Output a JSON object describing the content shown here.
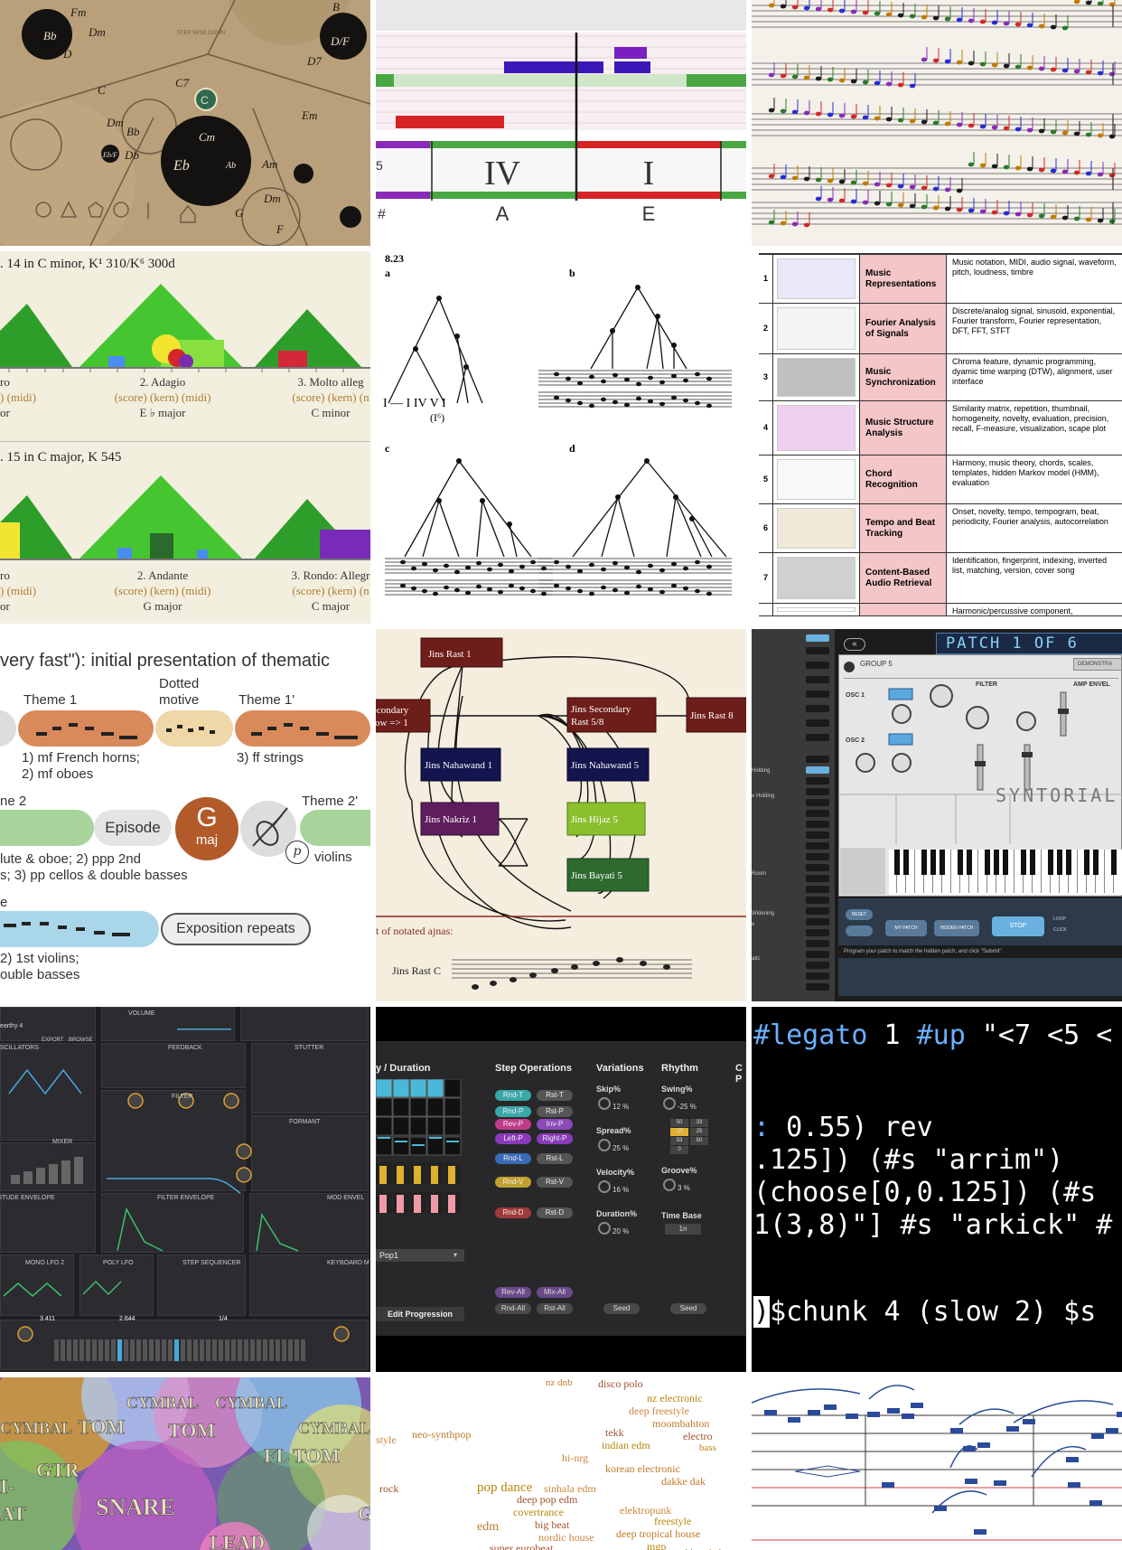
{
  "harmony_map": {
    "chords": [
      "Fm",
      "Dm",
      "B",
      "D/F",
      "D",
      "Bb",
      "D7",
      "C7",
      "Dm",
      "Em",
      "Cm",
      "Eb",
      "Am",
      "Ab",
      "Dm",
      "F",
      "Eb/F",
      "C",
      "Bb",
      "Db",
      "G"
    ],
    "center": "C",
    "main_chord": "Cm",
    "top_label": "STEP WISE DOWN"
  },
  "piano_roll": {
    "numerals": [
      "IV",
      "I"
    ],
    "notes": [
      "A",
      "E"
    ],
    "margin_labels": [
      "5",
      "#"
    ]
  },
  "score_page": {},
  "keyscape": {
    "rows": [
      {
        "title": ". 14 in C minor, K¹ 310/K⁶ 300d",
        "movements": [
          {
            "name": "ro",
            "links": ") (midi)",
            "key": "or"
          },
          {
            "name": "2. Adagio",
            "links": "(score) (kern) (midi)",
            "key": "E ♭ major"
          },
          {
            "name": "3. Molto alleg",
            "links": "(score) (kern) (n",
            "key": "C minor"
          }
        ]
      },
      {
        "title": ". 15 in C major, K 545",
        "movements": [
          {
            "name": "ro",
            "links": ") (midi)",
            "key": "or"
          },
          {
            "name": "2. Andante",
            "links": "(score) (kern) (midi)",
            "key": "G major"
          },
          {
            "name": "3. Rondo: Allegr",
            "links": "(score) (kern) (n",
            "key": "C major"
          }
        ]
      }
    ]
  },
  "tree": {
    "fig": "8.23",
    "labels": [
      "a",
      "b",
      "c",
      "d"
    ],
    "numerals": "I — I  IV V I",
    "sub": "(I⁶)"
  },
  "mir_table": {
    "rows": [
      {
        "n": "1",
        "topic": "Music Representations",
        "desc": "Music notation, MIDI, audio signal, waveform, pitch, loudness, timbre"
      },
      {
        "n": "2",
        "topic": "Fourier Analysis of Signals",
        "desc": "Discrete/analog signal, sinusoid, exponential, Fourier transform, Fourier representation, DFT, FFT, STFT"
      },
      {
        "n": "3",
        "topic": "Music Synchronization",
        "desc": "Chroma feature, dynamic programming, dyamic time warping (DTW), alignment, user interface"
      },
      {
        "n": "4",
        "topic": "Music Structure Analysis",
        "desc": "Similarity matrix, repetition, thumbnail, homogeneity, novelty, evaluation, precision, recall, F-measure, visualization, scape plot"
      },
      {
        "n": "5",
        "topic": "Chord Recognition",
        "desc": "Harmony, music theory, chords, scales, templates, hidden Markov model (HMM), evaluation"
      },
      {
        "n": "6",
        "topic": "Tempo and Beat Tracking",
        "desc": "Onset, novelty, tempo, tempogram, beat, periodicity, Fourier analysis, autocorrelation"
      },
      {
        "n": "7",
        "topic": "Content-Based Audio Retrieval",
        "desc": "Identification, fingerprint, indexing, inverted list, matching, version, cover song"
      },
      {
        "n": "",
        "topic": "",
        "desc": "Harmonic/percussive component,"
      }
    ]
  },
  "listening_guide": {
    "heading": "very fast\"): initial presentation of thematic",
    "theme1": "Theme 1",
    "dotted": "Dotted\nmotive",
    "theme1p": "Theme 1'",
    "inst1": "1) mf French horns;\n2) mf oboes",
    "inst2": "3) ff strings",
    "theme2": "ne 2",
    "theme2p": "Theme 2'",
    "episode": "Episode",
    "key_big": "G",
    "key_small": "maj",
    "dyn": "p",
    "violins": "violins",
    "inst3": "lute & oboe; 2) ppp 2nd\ns; 3) pp cellos & double basses",
    "row3": "e",
    "repeats": "Exposition repeats",
    "inst4": "2) 1st violins;\nouble basses"
  },
  "ajnas": {
    "nodes": [
      {
        "id": "rast1",
        "label": "Jins Rast 1"
      },
      {
        "id": "sec1",
        "label": "econdary\nlow => 1"
      },
      {
        "id": "sec58",
        "label": "Jins Secondary\nRast 5/8"
      },
      {
        "id": "rast8",
        "label": "Jins Rast 8"
      },
      {
        "id": "nah1",
        "label": "Jins Nahawand 1"
      },
      {
        "id": "nah5",
        "label": "Jins Nahawand 5"
      },
      {
        "id": "nak1",
        "label": "Jins Nakriz 1"
      },
      {
        "id": "hij5",
        "label": "Jins Hijaz 5"
      },
      {
        "id": "bay5",
        "label": "Jins Bayati 5"
      }
    ],
    "caption": "t of notated ajnas:",
    "scale": "Jins Rast C"
  },
  "syntorial": {
    "patch": "PATCH 1 OF 6",
    "group": "GROUP 5",
    "demo": "DEMONSTRA",
    "filter": "FILTER",
    "amp": "AMP ENVEL",
    "osc1": "OSC 1",
    "osc2": "OSC 2",
    "logo": "SYNTORIAL",
    "side_labels": [
      "Holding",
      "e Holding",
      "Room",
      "Widening",
      "e",
      "atic"
    ],
    "buttons": [
      "RESET",
      "MY PATCH",
      "HIDDEN PATCH",
      "STOP"
    ],
    "opts": [
      "LOOP",
      "CLICK"
    ],
    "footer": "Program your patch to match the hidden patch, and click \"Submit\"."
  },
  "vital": {
    "preset": "earthy 4",
    "menu": [
      "EXPORT",
      "BROWSE"
    ],
    "volume": "VOLUME",
    "feedback": "FEEDBACK",
    "stutter": "STUTTER",
    "oscillators": "SCILLATORS",
    "filter": "FILTER",
    "formant": "FORMANT",
    "mixer": "MIXER",
    "amp_env": "ITUDE ENVELOPE",
    "filter_env": "FILTER ENVELOPE",
    "mod_env": "MOD ENVEL",
    "lfo2": "MONO LFO 2",
    "poly_lfo": "POLY LFO",
    "step_seq": "STEP SEQUENCER",
    "keyboard": "KEYBOARD M",
    "val1": "3.411",
    "val2": "2.644",
    "val3": "1/4"
  },
  "progression": {
    "col1": "y / Duration",
    "col2": "Step Operations",
    "col3": "Variations",
    "col4": "Rhythm",
    "col5": "C P",
    "ops": [
      [
        "Rnd-T",
        "Rst-T"
      ],
      [
        "Rnd-P",
        "Rst-P"
      ],
      [
        "Rev-P",
        "Inv-P"
      ],
      [
        "Left-P",
        "Right-P"
      ],
      [
        "Rnd-L",
        "Rst-L"
      ],
      [
        "Rnd-V",
        "Rst-V"
      ],
      [
        "Rnd-D",
        "Rst-D"
      ]
    ],
    "vars": [
      [
        "Skip%",
        "12 %"
      ],
      [
        "Spread%",
        "25 %"
      ],
      [
        "Velocity%",
        "16 %"
      ],
      [
        "Duration%",
        "20 %"
      ]
    ],
    "swing": "Swing%",
    "swing_val": "-25 %",
    "groove": "Groove%",
    "groove_val": "3 %",
    "timebase": "Time Base",
    "timebase_val": "1n",
    "grid_vals": [
      "50",
      "33",
      "-25",
      "25",
      "33",
      "50",
      "0"
    ],
    "preset": "Pop1",
    "edit": "Edit Progression",
    "all": [
      "Rev-All",
      "Mix-All",
      "Rnd-All",
      "Rst-All"
    ],
    "seed": "Seed"
  },
  "tidal": {
    "lines": [
      "#legato 1 #up \"<7 <5 <",
      "",
      "  0.55) rev",
      ".125]) (#s \"arrim\")",
      "(choose[0,0.125]) (#s",
      "1(3,8)\"] #s \"arkick\" #",
      "",
      "$chunk 4 (slow 2) $s"
    ]
  },
  "drums": {
    "labels": [
      "CYMBAL",
      "CYMBAL",
      "CYMBAL",
      "TOM",
      "TOM",
      "CYMBAL",
      "FL TOM",
      "GTR",
      "I-",
      "AT",
      "SNARE",
      "G",
      "LEAD"
    ]
  },
  "genres": {
    "words": [
      "nz dnb",
      "disco polo",
      "nz electronic",
      "deep freestyle",
      "moombahton",
      "electro",
      "bass",
      "style",
      "neo-synthpop",
      "tekk",
      "indian edm",
      "hi-nrg",
      "korean electronic",
      "rock",
      "pop dance",
      "sinhala edm",
      "dakke dak",
      "deep pop edm",
      "covertrance",
      "elektropunk",
      "edm",
      "big beat",
      "freestyle",
      "nordic house",
      "deep tropical house",
      "super eurobeat",
      "mgp",
      "deep hardcore",
      "pakistani electr"
    ]
  },
  "notation": {}
}
